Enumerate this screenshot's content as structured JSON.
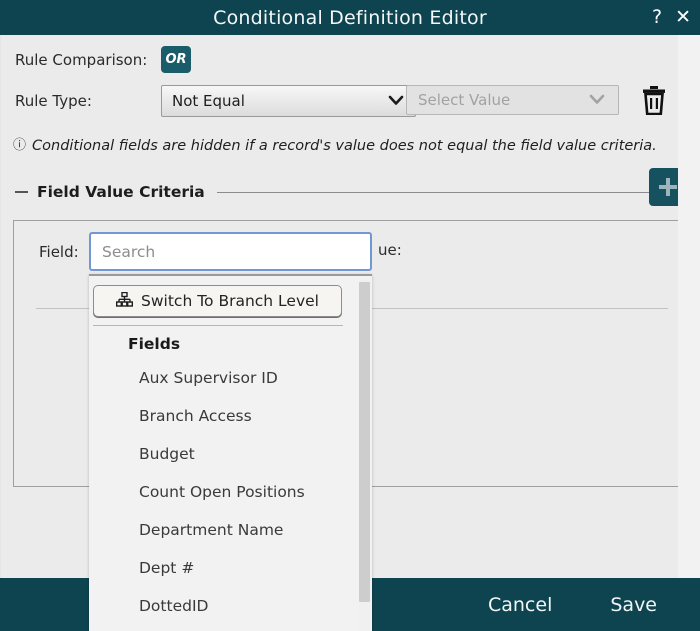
{
  "titlebar": {
    "title": "Conditional Definition Editor",
    "help_icon": "?",
    "close_icon": "✕"
  },
  "form": {
    "rule_comparison_label": "Rule Comparison:",
    "rule_comparison_value": "OR",
    "rule_type_label": "Rule Type:",
    "rule_type_value": "Not Equal"
  },
  "hint": {
    "icon": "ⓘ",
    "text": "Conditional fields are hidden if a record's value does not equal the field value criteria."
  },
  "section": {
    "title": "Field Value Criteria",
    "collapse_icon": "minus-icon",
    "add_icon": "plus-icon"
  },
  "criteria": {
    "field_label": "Field:",
    "value_label": "ue:",
    "value_placeholder": "Select Value",
    "delete_icon": "trash-icon",
    "caret_icon": "chevron-down-icon"
  },
  "search": {
    "placeholder": "Search",
    "value": ""
  },
  "dropdown": {
    "branch_button_label": "Switch To Branch Level",
    "branch_button_icon": "sitemap-icon",
    "group_title": "Fields",
    "items": [
      {
        "label": "Aux Supervisor ID"
      },
      {
        "label": "Branch Access"
      },
      {
        "label": "Budget"
      },
      {
        "label": "Count Open Positions"
      },
      {
        "label": "Department Name"
      },
      {
        "label": "Dept #"
      },
      {
        "label": "DottedID"
      }
    ]
  },
  "footer": {
    "cancel_label": "Cancel",
    "save_label": "Save"
  },
  "colors": {
    "brand_teal": "#0e4450",
    "badge_teal": "#1b5c6b",
    "add_button_teal": "#16515f",
    "body_bg": "#ebebeb",
    "focus_blue": "#7396d4"
  }
}
